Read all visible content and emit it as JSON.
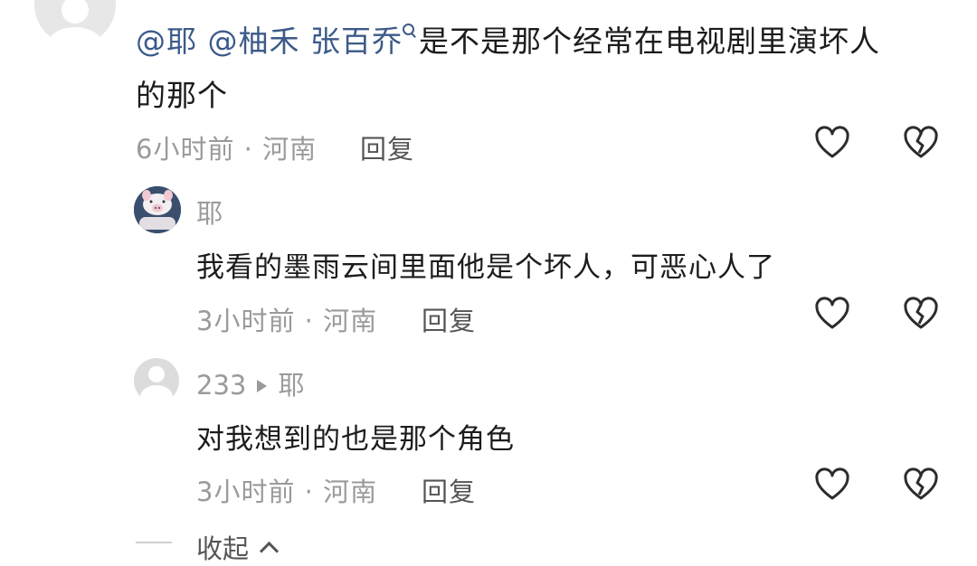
{
  "main_comment": {
    "mention1": "@耶",
    "mention2": "@柚禾 张百乔",
    "text_line1": "是不是那个经常在电视剧里演坏人",
    "text_line2": "的那个",
    "meta": "6小时前 · 河南",
    "reply_label": "回复"
  },
  "replies": [
    {
      "user": "耶",
      "text": "我看的墨雨云间里面他是个坏人，可恶心人了",
      "meta": "3小时前 · 河南",
      "reply_label": "回复"
    },
    {
      "user": "233",
      "reply_to": "耶",
      "text": "对我想到的也是那个角色",
      "meta": "3小时前 · 河南",
      "reply_label": "回复"
    }
  ],
  "collapse_label": "收起",
  "icons": [
    "heart-icon",
    "broken-heart-icon",
    "search-icon",
    "chevron-up-icon",
    "play-arrow-icon"
  ],
  "colors": {
    "mention": "#3c5a8a",
    "meta": "#9a9a9a",
    "text": "#1c1c1c"
  }
}
